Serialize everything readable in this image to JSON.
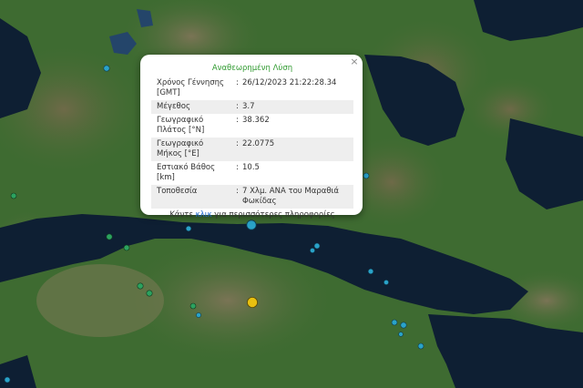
{
  "popup": {
    "title": "Αναθεωρημένη Λύση",
    "close_glyph": "×",
    "rows": [
      {
        "label": "Χρόνος Γέννησης [GMT]",
        "sep": ":",
        "value": "26/12/2023 21:22:28.34"
      },
      {
        "label": "Μέγεθος",
        "sep": ":",
        "value": "3.7"
      },
      {
        "label": "Γεωγραφικό Πλάτος [°N]",
        "sep": ":",
        "value": "38.362"
      },
      {
        "label": "Γεωγραφικό Μήκος [°E]",
        "sep": ":",
        "value": "22.0775"
      },
      {
        "label": "Εστιακό Βάθος [km]",
        "sep": ":",
        "value": "10.5"
      },
      {
        "label": "Τοποθεσία",
        "sep": ":",
        "value": "7 Χλμ. ΑΝΑ του Μαραθιά Φωκίδας"
      }
    ],
    "more_prefix": "Κάντε ",
    "more_link": "κλικ",
    "more_suffix": " για περισσότερες πληροφορίες"
  },
  "markers": [
    {
      "category": "recent-quake",
      "color": "#2aa3c9"
    },
    {
      "category": "older-quake",
      "color": "#2ca25f"
    },
    {
      "category": "intermediate-quake",
      "color": "#e8c010"
    }
  ],
  "colors": {
    "land": "#3e6b31",
    "mountain": "#5a5a3a",
    "water": "#0e1f33",
    "popup_title": "#2f9a2f",
    "link": "#1a66cc"
  }
}
